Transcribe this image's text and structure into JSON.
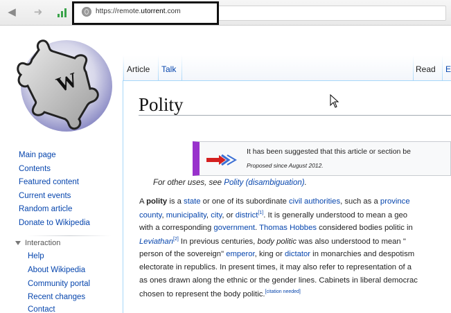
{
  "browser": {
    "url_prefix": "https://remote.",
    "url_domain": "utorrent",
    "url_suffix": ".com",
    "back_icon": "back-arrow-icon",
    "forward_icon": "forward-arrow-icon",
    "signal_icon": "signal-bars-icon",
    "accent": "#3aa34a"
  },
  "logo": {
    "letter": "W"
  },
  "sidebar": {
    "items": [
      "Main page",
      "Contents",
      "Featured content",
      "Current events",
      "Random article",
      "Donate to Wikipedia"
    ],
    "interaction_heading": "Interaction",
    "interaction_items": [
      "Help",
      "About Wikipedia",
      "Community portal",
      "Recent changes",
      "Contact"
    ]
  },
  "tabs": {
    "article": "Article",
    "talk": "Talk",
    "read": "Read",
    "edit_partial": "E"
  },
  "article": {
    "title": "Polity",
    "notice_line1": "It has been suggested that this article or section be",
    "notice_line2": "Proposed since August 2012.",
    "hatnote_prefix": "For other uses, see ",
    "hatnote_link": "Polity (disambiguation)",
    "hatnote_suffix": ".",
    "lines": [
      {
        "a": "A ",
        "b": "polity",
        "c": " is a ",
        "d": "state",
        "e": " or one of its subordinate ",
        "f": "civil authorities",
        "g": ", such as a ",
        "h": "province"
      },
      {
        "a": "county",
        "b": ", ",
        "c": "municipality",
        "d": ", ",
        "e": "city",
        "f": ", or ",
        "g": "district",
        "h": ". It is generally understood to mean a geo"
      },
      {
        "a": "with a corresponding ",
        "b": "government",
        "c": ". ",
        "d": "Thomas Hobbes",
        "e": " considered bodies politic in"
      },
      {
        "a": "Leviathan",
        "b": " In previous centuries, ",
        "c": "body politic",
        "d": " was also understood to mean \""
      },
      {
        "a": "person of the sovereign\" ",
        "b": "emperor",
        "c": ", king or ",
        "d": "dictator",
        "e": " in monarchies and despotism"
      },
      {
        "a": "electorate in republics. In present times, it may also refer to representation of a"
      },
      {
        "a": "as ones drawn along the ethnic or the gender lines. Cabinets in liberal democrac"
      },
      {
        "a": "chosen to represent the body politic.",
        "b": "[citation needed]"
      }
    ],
    "refs": [
      "[1]",
      "[2]"
    ]
  }
}
